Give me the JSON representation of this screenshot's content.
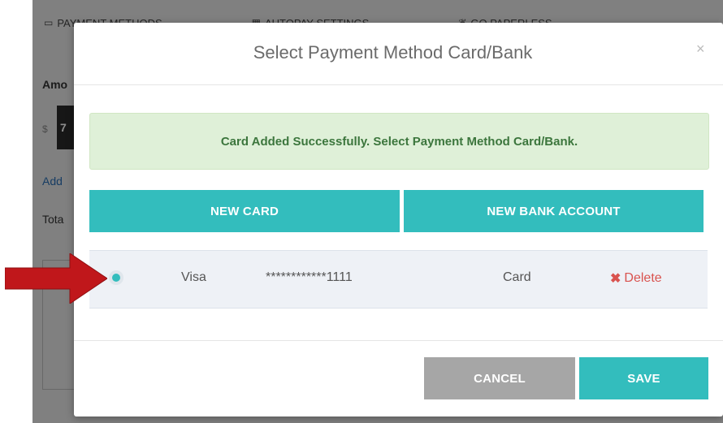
{
  "background_page": {
    "tabs": [
      {
        "icon": "credit-card-icon",
        "label": "PAYMENT METHODS"
      },
      {
        "icon": "calendar-icon",
        "label": "AUTOPAY SETTINGS"
      },
      {
        "icon": "leaf-icon",
        "label": "GO PAPERLESS"
      }
    ],
    "amount_label": "Amo",
    "currency_symbol": "$",
    "amount_partial": "7",
    "add_link": "Add",
    "total_label": "Tota"
  },
  "modal": {
    "title": "Select Payment Method Card/Bank",
    "close_symbol": "×",
    "alert_text": "Card Added Successfully. Select Payment Method Card/Bank.",
    "buttons": {
      "new_card": "NEW CARD",
      "new_bank_account": "NEW BANK ACCOUNT",
      "cancel": "CANCEL",
      "save": "SAVE"
    },
    "payment_methods": [
      {
        "selected": true,
        "brand": "Visa",
        "masked_number": "************1111",
        "type": "Card",
        "delete_label": "Delete"
      }
    ]
  },
  "colors": {
    "accent": "#33bdbd",
    "success_bg": "#dff0d8",
    "success_text": "#3c763d",
    "danger": "#d9534f",
    "cancel_gray": "#a6a6a6",
    "arrow_red": "#c0171b"
  }
}
